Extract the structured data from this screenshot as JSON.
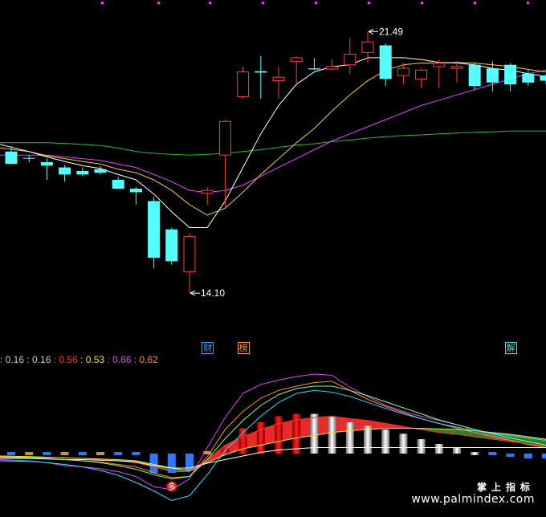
{
  "chart_data": [
    {
      "type": "candlestick",
      "panel": "price",
      "ylim": [
        12.9,
        22.2
      ],
      "colors": {
        "up": "#ff3b3b",
        "down": "#54ffff",
        "ma5": "#ffffff",
        "ma10": "#f0d040",
        "ma20": "#e040ff",
        "ma60": "#20c030"
      },
      "candles": [
        {
          "o": 18.1,
          "h": 18.25,
          "l": 17.75,
          "c": 17.75
        },
        {
          "o": 17.92,
          "h": 18.0,
          "l": 17.8,
          "c": 17.9
        },
        {
          "o": 17.8,
          "h": 17.9,
          "l": 17.3,
          "c": 17.7
        },
        {
          "o": 17.65,
          "h": 17.72,
          "l": 17.25,
          "c": 17.45
        },
        {
          "o": 17.55,
          "h": 17.65,
          "l": 17.4,
          "c": 17.45
        },
        {
          "o": 17.6,
          "h": 17.68,
          "l": 17.45,
          "c": 17.5
        },
        {
          "o": 17.3,
          "h": 17.38,
          "l": 17.05,
          "c": 17.05
        },
        {
          "o": 17.05,
          "h": 17.1,
          "l": 16.6,
          "c": 16.95
        },
        {
          "o": 16.7,
          "h": 16.82,
          "l": 14.8,
          "c": 15.1
        },
        {
          "o": 15.9,
          "h": 15.95,
          "l": 14.9,
          "c": 15.0
        },
        {
          "o": 14.7,
          "h": 15.8,
          "l": 14.1,
          "c": 15.7
        },
        {
          "o": 16.92,
          "h": 17.1,
          "l": 16.6,
          "c": 17.0
        },
        {
          "o": 18.0,
          "h": 19.0,
          "l": 16.55,
          "c": 18.95
        },
        {
          "o": 19.65,
          "h": 20.5,
          "l": 19.6,
          "c": 20.35
        },
        {
          "o": 20.37,
          "h": 20.8,
          "l": 19.6,
          "c": 20.33
        },
        {
          "o": 20.1,
          "h": 20.5,
          "l": 19.6,
          "c": 20.2
        },
        {
          "o": 20.65,
          "h": 20.8,
          "l": 20.0,
          "c": 20.75
        },
        {
          "o": 20.45,
          "h": 20.75,
          "l": 20.4,
          "c": 20.42
        },
        {
          "o": 20.43,
          "h": 20.7,
          "l": 20.4,
          "c": 20.5
        },
        {
          "o": 20.55,
          "h": 21.3,
          "l": 20.3,
          "c": 20.85
        },
        {
          "o": 20.9,
          "h": 21.49,
          "l": 20.6,
          "c": 21.2
        },
        {
          "o": 21.1,
          "h": 21.15,
          "l": 19.95,
          "c": 20.15
        },
        {
          "o": 20.25,
          "h": 20.6,
          "l": 20.0,
          "c": 20.45
        },
        {
          "o": 20.15,
          "h": 20.45,
          "l": 19.9,
          "c": 20.4
        },
        {
          "o": 20.5,
          "h": 20.7,
          "l": 19.9,
          "c": 20.6
        },
        {
          "o": 20.45,
          "h": 20.65,
          "l": 20.05,
          "c": 20.5
        },
        {
          "o": 20.55,
          "h": 20.6,
          "l": 19.85,
          "c": 19.95
        },
        {
          "o": 20.45,
          "h": 20.65,
          "l": 19.8,
          "c": 20.05
        },
        {
          "o": 20.55,
          "h": 20.6,
          "l": 19.8,
          "c": 20.0
        },
        {
          "o": 20.3,
          "h": 20.4,
          "l": 19.95,
          "c": 20.05
        },
        {
          "o": 20.25,
          "h": 20.3,
          "l": 20.0,
          "c": 20.1
        }
      ],
      "ma": {
        "ma5": [
          18.3,
          18.1,
          17.95,
          17.82,
          17.7,
          17.62,
          17.45,
          17.3,
          16.9,
          16.4,
          15.95,
          15.95,
          16.7,
          17.65,
          18.6,
          19.4,
          20.0,
          20.35,
          20.5,
          20.55,
          20.75,
          20.75,
          20.75,
          20.7,
          20.62,
          20.6,
          20.55,
          20.45,
          20.4,
          20.3,
          20.22
        ],
        "ma10": [
          18.2,
          18.1,
          17.98,
          17.9,
          17.82,
          17.75,
          17.6,
          17.5,
          17.3,
          17.0,
          16.6,
          16.3,
          16.5,
          16.95,
          17.45,
          17.9,
          18.35,
          18.75,
          19.25,
          19.7,
          20.1,
          20.4,
          20.55,
          20.6,
          20.6,
          20.62,
          20.6,
          20.55,
          20.5,
          20.42,
          20.35
        ],
        "ma20": [
          18.0,
          18.0,
          18.0,
          17.95,
          17.9,
          17.85,
          17.75,
          17.65,
          17.45,
          17.25,
          17.0,
          16.95,
          17.0,
          17.15,
          17.4,
          17.65,
          17.9,
          18.15,
          18.4,
          18.6,
          18.8,
          19.0,
          19.2,
          19.4,
          19.55,
          19.7,
          19.85,
          20.0,
          20.15,
          20.3,
          20.4
        ],
        "ma60": [
          18.35,
          18.35,
          18.35,
          18.33,
          18.3,
          18.27,
          18.2,
          18.1,
          18.05,
          18.02,
          18.0,
          18.02,
          18.05,
          18.1,
          18.15,
          18.22,
          18.28,
          18.32,
          18.38,
          18.42,
          18.48,
          18.52,
          18.55,
          18.57,
          18.6,
          18.62,
          18.64,
          18.66,
          18.68,
          18.68,
          18.68
        ]
      },
      "annotations": [
        {
          "text": "21.49",
          "candle": 20,
          "at": "high"
        },
        {
          "text": "14.10",
          "candle": 10,
          "at": "low"
        }
      ],
      "tags": [
        {
          "text": "财",
          "candle": 11,
          "color": "#40a0ff"
        },
        {
          "text": "榜",
          "candle": 13,
          "color": "#ff9a30"
        },
        {
          "text": "解",
          "candle": 28,
          "color": "#40e0e0"
        }
      ]
    },
    {
      "type": "bar+line",
      "panel": "indicator",
      "ylim": [
        -1.0,
        1.4
      ],
      "readout": [
        {
          "text": ": 0.16",
          "color": "#c8c8c8"
        },
        {
          "text": " : 0.16",
          "color": "#c8c8c8"
        },
        {
          "text": " : 0.56",
          "color": "#ff3030"
        },
        {
          "text": " : 0.53",
          "color": "#f0e040"
        },
        {
          "text": " : 0.66",
          "color": "#e040ff"
        },
        {
          "text": " : 0.62",
          "color": "#ff8a40"
        }
      ],
      "bars": [
        -0.02,
        0.0,
        -0.02,
        0.0,
        -0.02,
        0.0,
        -0.02,
        -0.02,
        -0.32,
        -0.32,
        -0.28,
        0.04,
        0.1,
        0.42,
        0.52,
        0.62,
        0.66,
        0.66,
        0.62,
        0.52,
        0.46,
        0.4,
        0.33,
        0.24,
        0.16,
        0.1,
        0.02,
        -0.02,
        -0.05,
        -0.08,
        -0.08
      ],
      "bar_colors": [
        "#2a7aff",
        "#c8963c",
        "#2a7aff",
        "#c8963c",
        "#2a7aff",
        "#c8963c",
        "#2a7aff",
        "#2a7aff",
        "#2a7aff",
        "#2a7aff",
        "#2a7aff",
        "#c8963c",
        "#e00000",
        "#e00000",
        "#e00000",
        "#e00000",
        "#e00000",
        "#e8e8e8",
        "#e8e8e8",
        "#e8e8e8",
        "#e8e8e8",
        "#e8e8e8",
        "#e8e8e8",
        "#e8e8e8",
        "#e8e8e8",
        "#e8e8e8",
        "#e8e8e8",
        "#2a7aff",
        "#2a7aff",
        "#2a7aff",
        "#2a7aff"
      ],
      "lines": [
        {
          "color": "#e040ff",
          "values": [
            -0.1,
            -0.12,
            -0.15,
            -0.2,
            -0.22,
            -0.25,
            -0.3,
            -0.38,
            -0.55,
            -0.6,
            -0.42,
            0.1,
            0.6,
            1.0,
            1.15,
            1.22,
            1.28,
            1.32,
            1.3,
            1.1,
            0.95,
            0.8,
            0.7,
            0.62,
            0.55,
            0.48,
            0.4,
            0.3,
            0.22,
            0.15,
            0.1
          ]
        },
        {
          "color": "#ff8a40",
          "values": [
            -0.05,
            -0.06,
            -0.08,
            -0.1,
            -0.12,
            -0.14,
            -0.18,
            -0.22,
            -0.32,
            -0.4,
            -0.38,
            -0.05,
            0.4,
            0.7,
            0.92,
            1.05,
            1.12,
            1.18,
            1.2,
            1.05,
            0.9,
            0.78,
            0.68,
            0.58,
            0.5,
            0.42,
            0.35,
            0.28,
            0.22,
            0.15,
            0.1
          ]
        },
        {
          "color": "#ff3030",
          "values": [
            -0.04,
            -0.05,
            -0.06,
            -0.07,
            -0.08,
            -0.1,
            -0.12,
            -0.15,
            -0.22,
            -0.3,
            -0.3,
            -0.1,
            0.14,
            0.28,
            0.4,
            0.5,
            0.56,
            0.6,
            0.62,
            0.58,
            0.55,
            0.5,
            0.45,
            0.4,
            0.35,
            0.32,
            0.28,
            0.24,
            0.2,
            0.16,
            0.12
          ]
        },
        {
          "color": "#f0e040",
          "values": [
            -0.04,
            -0.05,
            -0.06,
            -0.07,
            -0.08,
            -0.09,
            -0.1,
            -0.12,
            -0.18,
            -0.24,
            -0.28,
            -0.15,
            -0.02,
            0.08,
            0.14,
            0.2,
            0.26,
            0.3,
            0.35,
            0.38,
            0.4,
            0.42,
            0.42,
            0.42,
            0.41,
            0.4,
            0.38,
            0.35,
            0.32,
            0.28,
            0.24
          ]
        },
        {
          "color": "#ffffff",
          "values": [
            -0.08,
            -0.08,
            -0.09,
            -0.1,
            -0.1,
            -0.11,
            -0.12,
            -0.14,
            -0.2,
            -0.24,
            -0.24,
            -0.16,
            -0.1,
            -0.04,
            0.02,
            0.06,
            0.08,
            0.1,
            0.1,
            0.1,
            0.1,
            0.1,
            0.1,
            0.1,
            0.1,
            0.1,
            0.1,
            0.1,
            0.1,
            0.1,
            0.1
          ]
        },
        {
          "color": "#20e0ff",
          "values": [
            -0.12,
            -0.13,
            -0.15,
            -0.18,
            -0.22,
            -0.28,
            -0.36,
            -0.48,
            -0.62,
            -0.78,
            -0.7,
            -0.35,
            0.05,
            0.35,
            0.62,
            0.85,
            1.0,
            1.05,
            1.02,
            0.95,
            0.85,
            0.75,
            0.66,
            0.58,
            0.5,
            0.44,
            0.38,
            0.34,
            0.3,
            0.26,
            0.22
          ]
        },
        {
          "color": "#80ff80",
          "values": [
            -0.06,
            -0.07,
            -0.08,
            -0.1,
            -0.12,
            -0.15,
            -0.2,
            -0.26,
            -0.35,
            -0.42,
            -0.38,
            -0.1,
            0.25,
            0.55,
            0.8,
            0.98,
            1.08,
            1.12,
            1.12,
            1.05,
            0.96,
            0.86,
            0.76,
            0.66,
            0.56,
            0.48,
            0.4,
            0.33,
            0.26,
            0.2,
            0.14
          ]
        }
      ],
      "fills": {
        "positive": "#ff3030",
        "negative": "#3a8a30"
      },
      "marker": {
        "text": "多",
        "candle": 10,
        "color": "#e02020"
      }
    }
  ],
  "watermark": {
    "cn": "掌上指标",
    "url": "www.palmindex.com"
  }
}
